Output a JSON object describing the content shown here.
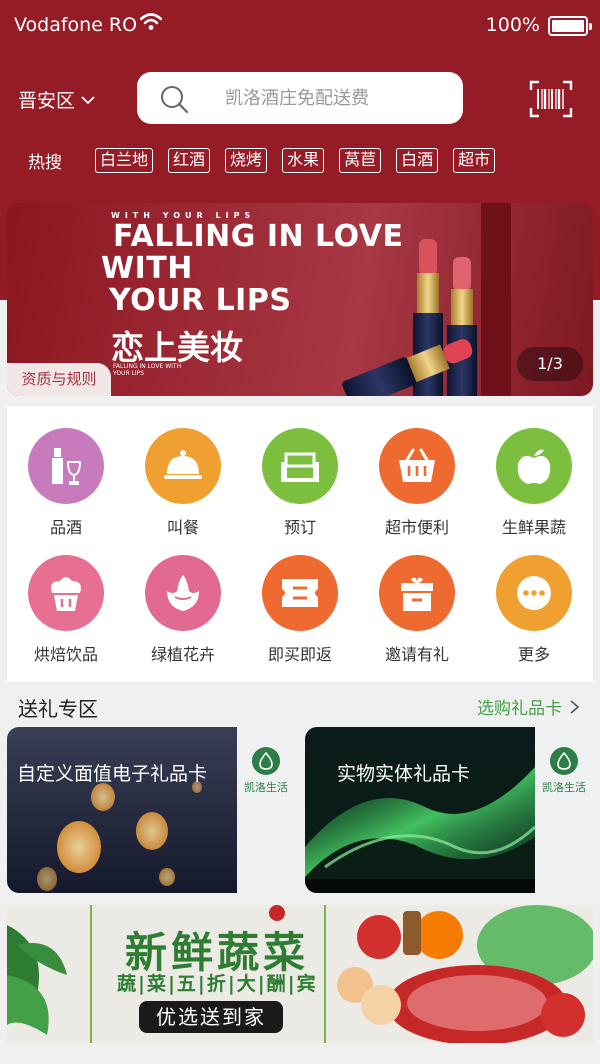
{
  "status_bar": {
    "carrier": "Vodafone RO",
    "battery": "100%"
  },
  "header": {
    "location": "晋安区",
    "search_placeholder": "凯洛酒庄免配送费",
    "hot_label": "热搜",
    "hot_tags": [
      "白兰地",
      "红酒",
      "烧烤",
      "水果",
      "莴苣",
      "白酒",
      "超市"
    ]
  },
  "banner": {
    "top_small": "WITH YOUR LIPS",
    "line1": "FALLING IN LOVE",
    "line2": "WITH",
    "line3": "YOUR LIPS",
    "zh_title": "恋上美妆",
    "tiny_text": "FALLING IN LOVE WITH YOUR LIPS",
    "rules_button": "资质与规则",
    "pager": "1/3"
  },
  "categories": [
    {
      "label": "品酒",
      "icon": "wine-bottle-icon",
      "color": "#c77bbd"
    },
    {
      "label": "叫餐",
      "icon": "food-cloche-icon",
      "color": "#f0a030"
    },
    {
      "label": "预订",
      "icon": "sofa-icon",
      "color": "#7cbf3e"
    },
    {
      "label": "超市便利",
      "icon": "basket-icon",
      "color": "#ef6a30"
    },
    {
      "label": "生鲜果蔬",
      "icon": "apple-icon",
      "color": "#7cbf3e"
    },
    {
      "label": "烘焙饮品",
      "icon": "cupcake-icon",
      "color": "#e76f91"
    },
    {
      "label": "绿植花卉",
      "icon": "flower-icon",
      "color": "#e2698f"
    },
    {
      "label": "即买即返",
      "icon": "ticket-icon",
      "color": "#ef6a30"
    },
    {
      "label": "邀请有礼",
      "icon": "gift-box-icon",
      "color": "#ef6a30"
    },
    {
      "label": "更多",
      "icon": "more-dots-icon",
      "color": "#f0a030"
    }
  ],
  "gift": {
    "section_title": "送礼专区",
    "more_link": "选购礼品卡",
    "cards": [
      {
        "title": "自定义面值电子礼品卡",
        "brand": "凯洛生活"
      },
      {
        "title": "实物实体礼品卡",
        "brand": "凯洛生活"
      }
    ]
  },
  "veg_banner": {
    "title": "新鲜蔬菜",
    "subtitle": "蔬|菜|五|折|大|酬|宾",
    "button": "优选送到家"
  },
  "colors": {
    "header": "#951c26",
    "accent_green": "#43a047"
  }
}
